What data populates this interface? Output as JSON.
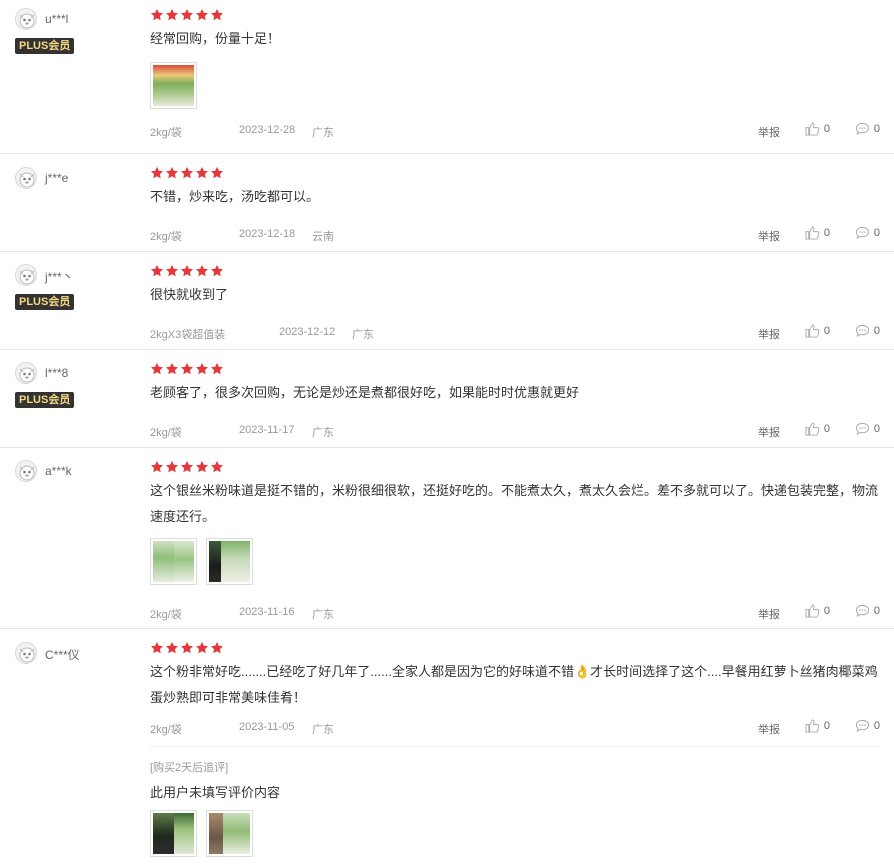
{
  "colors": {
    "star": "#e4393c",
    "plus_bg": "#333333",
    "plus_text": "#f5d87f"
  },
  "actions": {
    "report_label": "举报"
  },
  "reviews": [
    {
      "user": "u***l",
      "plus": "PLUS会员",
      "rating": 5,
      "content": "经常回购，份量十足！",
      "spec": "2kg/袋",
      "date": "2023-12-28",
      "location": "广东",
      "likes": "0",
      "replies": "0"
    },
    {
      "user": "j***e",
      "rating": 5,
      "content": "不错，炒来吃，汤吃都可以。",
      "spec": "2kg/袋",
      "date": "2023-12-18",
      "location": "云南",
      "likes": "0",
      "replies": "0"
    },
    {
      "user": "j***丶",
      "plus": "PLUS会员",
      "rating": 5,
      "content": "很快就收到了",
      "spec": "2kgX3袋超值装",
      "date": "2023-12-12",
      "location": "广东",
      "likes": "0",
      "replies": "0"
    },
    {
      "user": "l***8",
      "plus": "PLUS会员",
      "rating": 5,
      "content": "老顾客了，很多次回购，无论是炒还是煮都很好吃，如果能时时优惠就更好",
      "spec": "2kg/袋",
      "date": "2023-11-17",
      "location": "广东",
      "likes": "0",
      "replies": "0"
    },
    {
      "user": "a***k",
      "rating": 5,
      "content": "这个银丝米粉味道是挺不错的，米粉很细很软，还挺好吃的。不能煮太久，煮太久会烂。差不多就可以了。快递包装完整，物流速度还行。",
      "spec": "2kg/袋",
      "date": "2023-11-16",
      "location": "广东",
      "likes": "0",
      "replies": "0"
    },
    {
      "user": "C***仪",
      "rating": 5,
      "content": "这个粉非常好吃.......已经吃了好几年了......全家人都是因为它的好味道不错👌才长时间选择了这个....早餐用红萝卜丝猪肉椰菜鸡蛋炒熟即可非常美味佳肴！",
      "spec": "2kg/袋",
      "date": "2023-11-05",
      "location": "广东",
      "likes": "0",
      "replies": "0",
      "followup": {
        "tag": "[购买2天后追评]",
        "text": "此用户未填写评价内容"
      }
    }
  ]
}
